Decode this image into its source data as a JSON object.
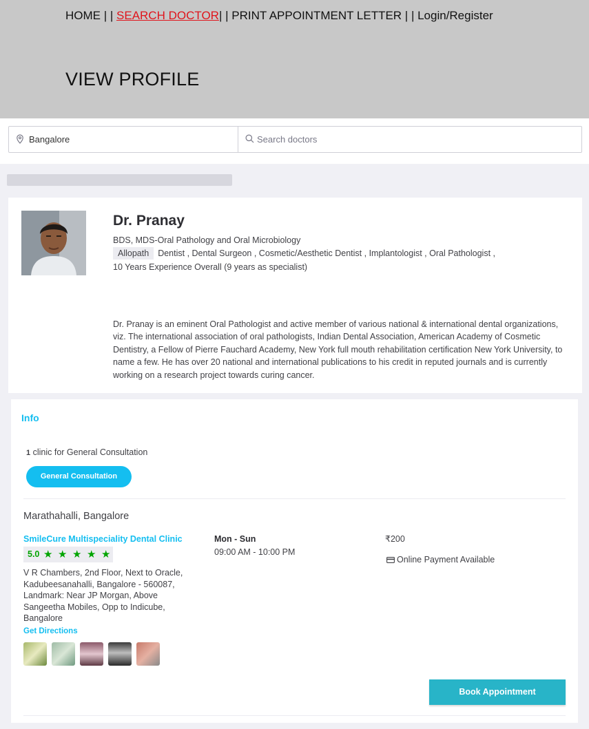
{
  "nav": {
    "sep_1": "HOME |  |",
    "search_doctor": "SEARCH DOCTOR ",
    "sep_2": "|  | PRINT APPOINTMENT LETTER |  | Login/Register"
  },
  "page_heading": "VIEW PROFILE",
  "search": {
    "location_value": "Bangalore",
    "doctor_placeholder": "Search doctors"
  },
  "doctor": {
    "name": "Dr. Pranay",
    "qualifications": "BDS, MDS-Oral Pathology and Oral Microbiology",
    "system": "Allopath",
    "specializations": "Dentist , Dental Surgeon , Cosmetic/Aesthetic Dentist , Implantologist , Oral Pathologist ,",
    "experience": "10 Years Experience Overall  (9 years as specialist)",
    "about": "Dr. Pranay is an eminent Oral Pathologist and active member of various national & international dental organizations, viz. The international association of oral pathologists, Indian Dental Association, American Academy of Cosmetic Dentistry, a Fellow of Pierre Fauchard Academy, New York full mouth rehabilitation certification New York University, to name a few. He has over 20 national and international publications to his credit in reputed journals and is currently working on a research project towards curing cancer."
  },
  "info": {
    "title": "Info",
    "clinic_count": "1",
    "clinic_count_suffix": "clinic   for General Consultation",
    "consult_pill": "General Consultation",
    "locality": "Marathahalli, Bangalore",
    "clinic": {
      "name": "SmileCure Multispeciality Dental Clinic",
      "rating": "5.0",
      "stars": 5,
      "address": "V R Chambers, 2nd Floor, Next to Oracle, Kadubeesanahalli, Bangalore - 560087, Landmark: Near JP Morgan, Above Sangeetha Mobiles, Opp to Indicube, Bangalore",
      "directions": "Get Directions",
      "days": "Mon - Sun",
      "hours": "09:00 AM - 10:00 PM",
      "fee": "₹200",
      "payment": "Online Payment Available"
    },
    "book_button": "Book Appointment"
  },
  "colors": {
    "accent": "#14bef0",
    "rating_green": "#01a400",
    "active_link": "#e0141b",
    "book_button": "#28b4c8"
  }
}
